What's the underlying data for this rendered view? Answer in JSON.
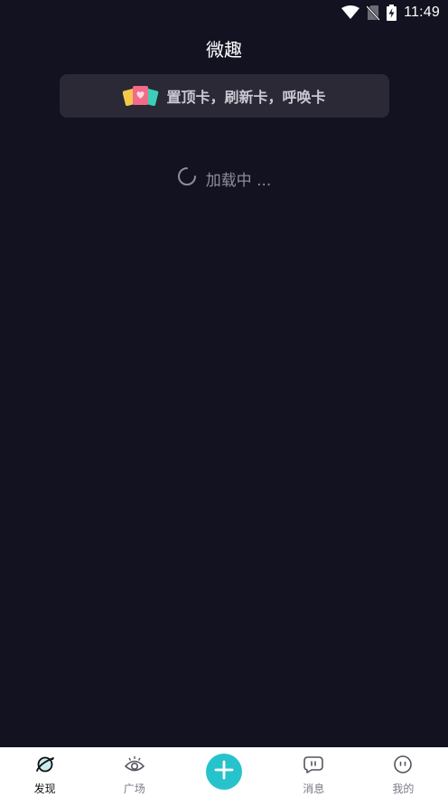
{
  "status_bar": {
    "time": "11:49",
    "icons": [
      "wifi-icon",
      "no-sim-icon",
      "battery-charging-icon"
    ]
  },
  "header": {
    "title": "微趣"
  },
  "promo": {
    "icon": "cards-icon",
    "text": "置顶卡，刷新卡，呼唤卡"
  },
  "loading": {
    "icon": "spinner-icon",
    "text": "加载中 ..."
  },
  "bottom_nav": {
    "items": [
      {
        "label": "发现",
        "icon": "planet-icon",
        "active": true
      },
      {
        "label": "广场",
        "icon": "eye-icon",
        "active": false
      },
      {
        "label": "",
        "icon": "plus-icon",
        "active": false
      },
      {
        "label": "消息",
        "icon": "chat-bubble-icon",
        "active": false
      },
      {
        "label": "我的",
        "icon": "face-icon",
        "active": false
      }
    ],
    "colors": {
      "accent": "#27c3cc",
      "active_text": "#121212",
      "inactive_text": "#7a7a84"
    }
  },
  "colors": {
    "background": "#131221",
    "banner": "#2a2935"
  }
}
